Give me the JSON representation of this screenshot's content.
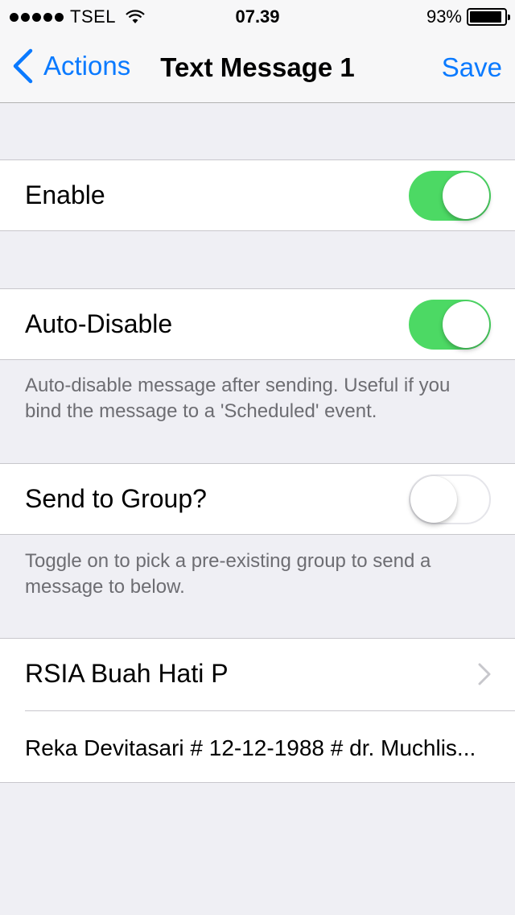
{
  "status": {
    "carrier": "TSEL",
    "time": "07.39",
    "battery_percent": "93%",
    "battery_level": 0.93
  },
  "nav": {
    "back_label": "Actions",
    "title": "Text Message 1",
    "save_label": "Save"
  },
  "settings": {
    "enable": {
      "label": "Enable",
      "on": true
    },
    "auto_disable": {
      "label": "Auto-Disable",
      "on": true,
      "footer": "Auto-disable message after sending. Useful if you bind the message to a 'Scheduled' event."
    },
    "send_to_group": {
      "label": "Send to Group?",
      "on": false,
      "footer": "Toggle on to pick a pre-existing group to send a message to below."
    }
  },
  "group": {
    "selected": "RSIA Buah Hati P",
    "message": "Reka Devitasari # 12-12-1988 # dr. Muchlis..."
  },
  "colors": {
    "accent": "#0a7aff",
    "toggle_on": "#4cd964",
    "background": "#efeff4"
  }
}
